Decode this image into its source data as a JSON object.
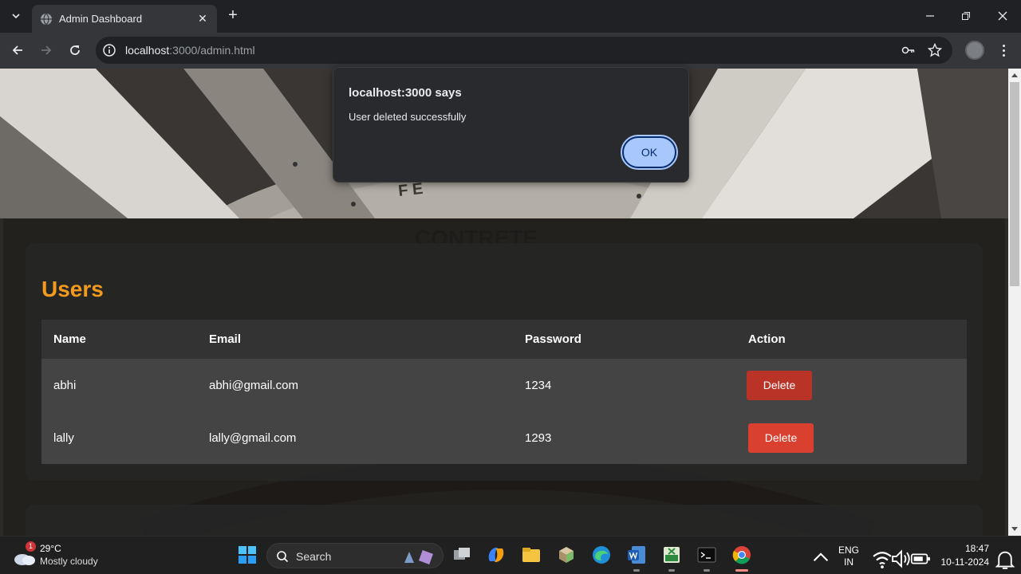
{
  "browser": {
    "tab_title": "Admin Dashboard",
    "url_host": "localhost",
    "url_path": ":3000/admin.html",
    "new_tab_symbol": "+",
    "tab_close_symbol": "✕"
  },
  "dialog": {
    "title": "localhost:3000 says",
    "message": "User deleted successfully",
    "ok_label": "OK"
  },
  "users": {
    "title": "Users",
    "columns": [
      "Name",
      "Email",
      "Password",
      "Action"
    ],
    "rows": [
      {
        "name": "abhi",
        "email": "abhi@gmail.com",
        "password": "1234",
        "action": "Delete"
      },
      {
        "name": "lally",
        "email": "lally@gmail.com",
        "password": "1293",
        "action": "Delete"
      }
    ]
  },
  "taskbar": {
    "weather_temp": "29°C",
    "weather_cond": "Mostly cloudy",
    "weather_badge": "1",
    "search_label": "Search",
    "lang_top": "ENG",
    "lang_bottom": "IN",
    "time": "18:47",
    "date": "10-11-2024"
  },
  "colors": {
    "accent_orange": "#f29a1d",
    "delete_red": "#d9402f",
    "ok_blue": "#a8c7fa"
  },
  "icons": [
    "tab-search-icon",
    "favicon-icon",
    "close-icon",
    "new-tab-icon",
    "minimize-icon",
    "maximize-icon",
    "window-close-icon",
    "back-icon",
    "forward-icon",
    "reload-icon",
    "site-info-icon",
    "password-key-icon",
    "bookmark-star-icon",
    "profile-avatar-icon",
    "menu-icon",
    "windows-start-icon",
    "search-icon",
    "task-view-icon",
    "copilot-icon",
    "file-explorer-icon",
    "app-icon",
    "edge-icon",
    "word-icon",
    "excel-icon",
    "terminal-icon",
    "chrome-icon",
    "tray-chevron-icon",
    "wifi-icon",
    "volume-icon",
    "battery-icon",
    "notification-icon"
  ]
}
